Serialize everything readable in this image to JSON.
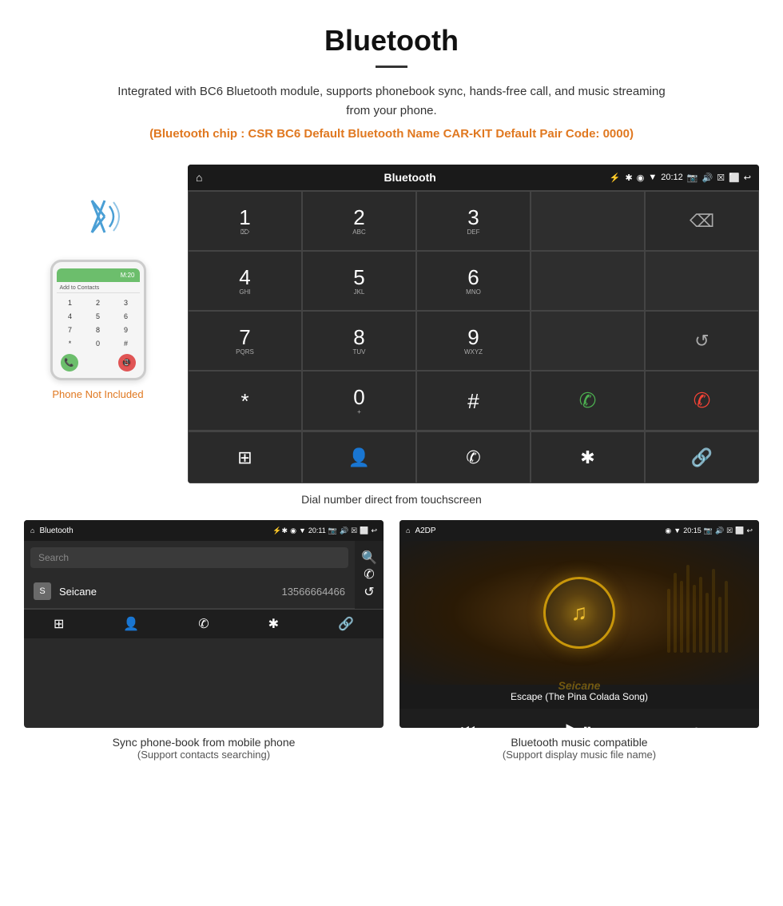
{
  "header": {
    "title": "Bluetooth",
    "description": "Integrated with BC6 Bluetooth module, supports phonebook sync, hands-free call, and music streaming from your phone.",
    "specs": "(Bluetooth chip : CSR BC6    Default Bluetooth Name CAR-KIT    Default Pair Code: 0000)"
  },
  "phone_mockup": {
    "not_included_label": "Phone Not Included",
    "add_contacts": "Add to Contacts",
    "phone_number": "M:20",
    "keys": [
      "1",
      "2",
      "3",
      "4",
      "5",
      "6",
      "7",
      "8",
      "9",
      "*",
      "0",
      "#"
    ]
  },
  "dial_screen": {
    "title": "Bluetooth",
    "time": "20:12",
    "keys": [
      {
        "num": "1",
        "sub": "⌦"
      },
      {
        "num": "2",
        "sub": "ABC"
      },
      {
        "num": "3",
        "sub": "DEF"
      },
      {
        "num": "",
        "sub": ""
      },
      {
        "num": "⌫",
        "sub": ""
      },
      {
        "num": "4",
        "sub": "GHI"
      },
      {
        "num": "5",
        "sub": "JKL"
      },
      {
        "num": "6",
        "sub": "MNO"
      },
      {
        "num": "",
        "sub": ""
      },
      {
        "num": "",
        "sub": ""
      },
      {
        "num": "7",
        "sub": "PQRS"
      },
      {
        "num": "8",
        "sub": "TUV"
      },
      {
        "num": "9",
        "sub": "WXYZ"
      },
      {
        "num": "",
        "sub": ""
      },
      {
        "num": "↺",
        "sub": ""
      },
      {
        "num": "*",
        "sub": ""
      },
      {
        "num": "0",
        "sub": "+"
      },
      {
        "num": "#",
        "sub": ""
      },
      {
        "num": "✆",
        "sub": "green"
      },
      {
        "num": "✆",
        "sub": "red"
      }
    ],
    "bottom_icons": [
      "⊞",
      "👤",
      "✆",
      "✱",
      "🔗"
    ],
    "caption": "Dial number direct from touchscreen"
  },
  "phonebook_screen": {
    "title": "Bluetooth",
    "time": "20:11",
    "search_placeholder": "Search",
    "contact": {
      "letter": "S",
      "name": "Seicane",
      "number": "13566664466"
    },
    "caption_main": "Sync phone-book from mobile phone",
    "caption_sub": "(Support contacts searching)"
  },
  "music_screen": {
    "title": "A2DP",
    "time": "20:15",
    "track_title": "Escape (The Pina Colada Song)",
    "caption_main": "Bluetooth music compatible",
    "caption_sub": "(Support display music file name)",
    "watermark": "Seicane"
  }
}
